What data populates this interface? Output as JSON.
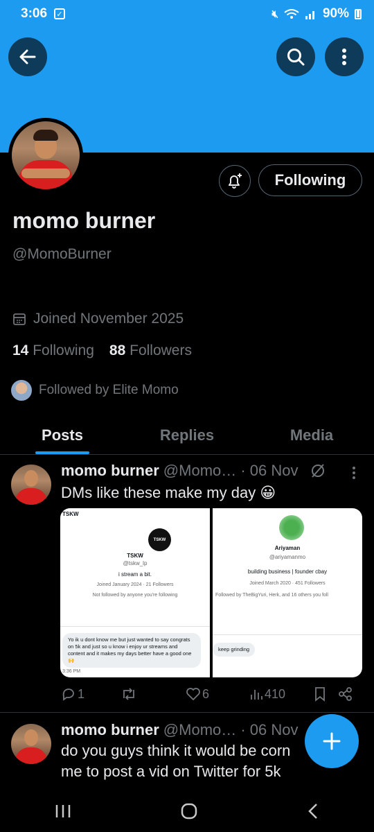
{
  "status": {
    "time": "3:06",
    "battery": "90%"
  },
  "profile": {
    "display_name": "momo burner",
    "handle": "@MomoBurner",
    "joined": "Joined November 2025",
    "following_count": "14",
    "following_label": "Following",
    "followers_count": "88",
    "followers_label": "Followers",
    "followed_by": "Followed by Elite Momo",
    "follow_button": "Following"
  },
  "tabs": [
    {
      "label": "Posts",
      "active": true
    },
    {
      "label": "Replies",
      "active": false
    },
    {
      "label": "Media",
      "active": false
    }
  ],
  "posts": [
    {
      "name": "momo burner",
      "meta": "@Momo… · 06 Nov",
      "text": "DMs like these make my day 😀",
      "media": {
        "left": {
          "tag": "TSKW",
          "logo": "TSKW",
          "name": "TSKW",
          "handle": "@tskw_lp",
          "bio": "i stream a bit.",
          "joined": "Joined January 2024 · 21 Followers",
          "note": "Not followed by anyone you're following",
          "message": "Yo ik u dont know me but just wanted to say congrats on 5k and just so u know i enjoy ur streams and content and it makes my days better have a good one 🙌",
          "time": "3:36 PM"
        },
        "right": {
          "name": "Ariyaman",
          "handle": "@ariyamanmo",
          "bio": "building business | founder cbay",
          "joined": "Joined March 2020 · 451 Followers",
          "note": "Followed by TheBigYuri, Herk, and 16 others you foll",
          "message": "keep grinding"
        }
      },
      "replies": "1",
      "reposts": "",
      "likes": "6",
      "views": "410"
    },
    {
      "name": "momo burner",
      "meta": "@Momo… · 06 Nov",
      "text_line1": "do you guys think it would be corn",
      "text_line2": "me to post a vid on Twitter for 5k"
    }
  ]
}
